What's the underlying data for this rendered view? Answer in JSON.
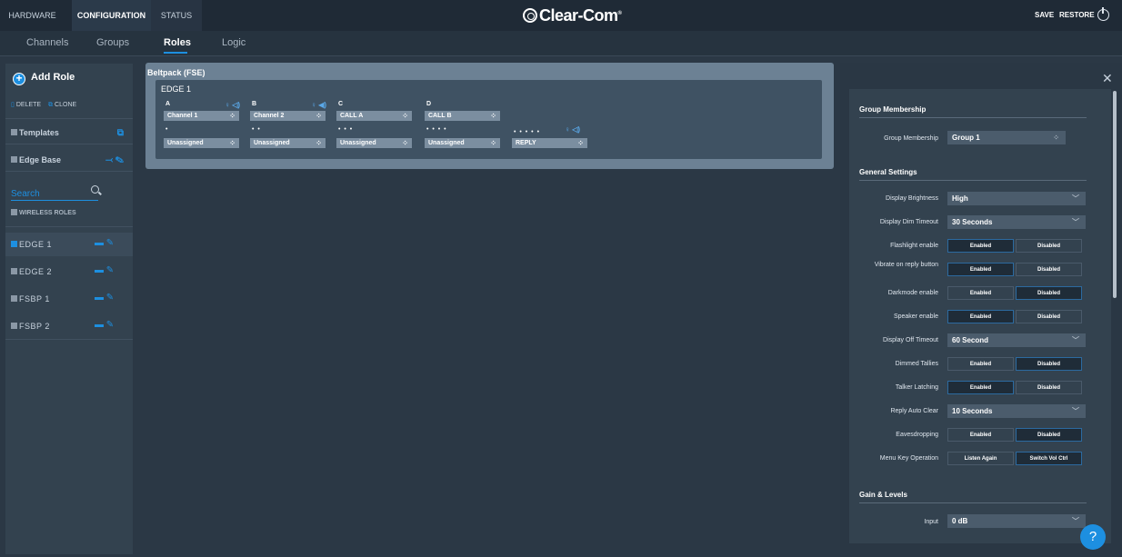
{
  "topbar": {
    "tabs": [
      {
        "label": "HARDWARE"
      },
      {
        "label": "CONFIGURATION"
      },
      {
        "label": "STATUS"
      }
    ],
    "logo": "Clear-Com",
    "logo_mark": "®",
    "save": "SAVE",
    "restore": "RESTORE"
  },
  "subnav": {
    "tabs": [
      {
        "label": "Channels"
      },
      {
        "label": "Groups"
      },
      {
        "label": "Roles"
      },
      {
        "label": "Logic"
      }
    ],
    "active": "Roles"
  },
  "left": {
    "add_role": "Add Role",
    "delete": "DELETE",
    "clone": "CLONE",
    "templates": "Templates",
    "edge_base": "Edge Base",
    "search_placeholder": "Search",
    "wireless_roles": "WIRELESS ROLES",
    "roles": [
      {
        "name": "EDGE 1",
        "checked": true
      },
      {
        "name": "EDGE 2",
        "checked": false
      },
      {
        "name": "FSBP 1",
        "checked": false
      },
      {
        "name": "FSBP 2",
        "checked": false
      }
    ]
  },
  "card": {
    "title": "Beltpack (FSE)",
    "role_name": "EDGE 1",
    "keys": [
      {
        "label": "A",
        "channel": "Channel 1",
        "secondary": "Unassigned",
        "dots": "•"
      },
      {
        "label": "B",
        "channel": "Channel 2",
        "secondary": "Unassigned",
        "dots": "• •"
      },
      {
        "label": "C",
        "channel": "CALL A",
        "secondary": "Unassigned",
        "dots": "• • •"
      },
      {
        "label": "D",
        "channel": "CALL B",
        "secondary": "Unassigned",
        "dots": "• • • •"
      },
      {
        "label": "",
        "channel": "",
        "secondary": "REPLY",
        "dots": "• • • • •"
      }
    ]
  },
  "settings": {
    "group_membership": {
      "title": "Group Membership",
      "label": "Group Membership",
      "value": "Group 1"
    },
    "general": {
      "title": "General Settings",
      "display_brightness": {
        "label": "Display Brightness",
        "value": "High"
      },
      "display_dim_timeout": {
        "label": "Display Dim Timeout",
        "value": "30 Seconds"
      },
      "flashlight": {
        "label": "Flashlight enable",
        "on": "Enabled",
        "off": "Disabled",
        "selected": "Enabled"
      },
      "vibrate": {
        "label": "Vibrate on reply button",
        "on": "Enabled",
        "off": "Disabled",
        "selected": "Enabled"
      },
      "darkmode": {
        "label": "Darkmode enable",
        "on": "Enabled",
        "off": "Disabled",
        "selected": "Disabled"
      },
      "speaker": {
        "label": "Speaker enable",
        "on": "Enabled",
        "off": "Disabled",
        "selected": "Enabled"
      },
      "display_off_timeout": {
        "label": "Display Off Timeout",
        "value": "60 Second"
      },
      "dimmed_tallies": {
        "label": "Dimmed Tallies",
        "on": "Enabled",
        "off": "Disabled",
        "selected": "Disabled"
      },
      "talker_latching": {
        "label": "Talker Latching",
        "on": "Enabled",
        "off": "Disabled",
        "selected": "Enabled"
      },
      "reply_auto_clear": {
        "label": "Reply Auto Clear",
        "value": "10 Seconds"
      },
      "eavesdropping": {
        "label": "Eavesdropping",
        "on": "Enabled",
        "off": "Disabled",
        "selected": "Disabled"
      },
      "menu_key": {
        "label": "Menu Key Operation",
        "on": "Listen Again",
        "off": "Switch Vol Ctrl",
        "selected": "Switch Vol Ctrl"
      }
    },
    "gain": {
      "title": "Gain & Levels",
      "input": {
        "label": "Input",
        "value": "0 dB"
      }
    }
  },
  "help": "?",
  "colors": {
    "accent": "#1d8fe0",
    "topbar": "#1f2a36",
    "panel": "#33424f",
    "card": "#6c8194"
  }
}
